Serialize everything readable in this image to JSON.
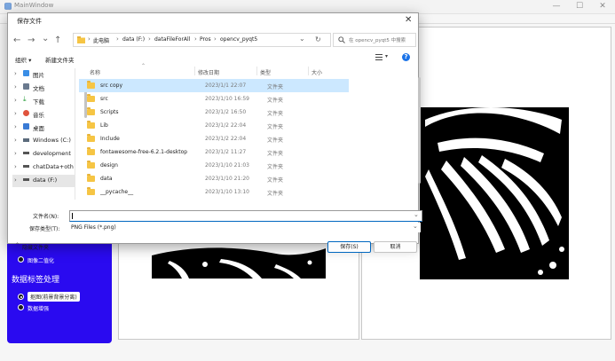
{
  "main_window": {
    "title": "MainWindow",
    "controls": {
      "minimize": "—",
      "maximize": "☐",
      "close": "✕"
    }
  },
  "sidebar": {
    "items": [
      {
        "label": "图像二值化",
        "checked": false
      },
      {
        "label": "数据标签处理",
        "heading": true
      },
      {
        "label": "抠图(前景背景分离)",
        "checked": true
      },
      {
        "label": "数据增强",
        "checked": false
      }
    ]
  },
  "dialog": {
    "title": "保存文件",
    "close": "✕",
    "nav": {
      "back": "←",
      "forward": "→",
      "dropdown": "⌄",
      "up": "↑",
      "refresh": "↻"
    },
    "breadcrumb": [
      "此电脑",
      "data (F:)",
      "dataFileForAll",
      "Pros",
      "opencv_pyqt5"
    ],
    "search_placeholder": "在 opencv_pyqt5 中搜索",
    "toolbar": {
      "organize": "组织 ▾",
      "new_folder": "新建文件夹",
      "help": "?"
    },
    "nav_pane": [
      {
        "label": "图片",
        "icon": "pictures-icon",
        "color": "#3a8ee6"
      },
      {
        "label": "文档",
        "icon": "documents-icon",
        "color": "#6b7a8f"
      },
      {
        "label": "下载",
        "icon": "downloads-icon",
        "color": "#2a9d3a"
      },
      {
        "label": "音乐",
        "icon": "music-icon",
        "color": "#e0533d"
      },
      {
        "label": "桌面",
        "icon": "desktop-icon",
        "color": "#3a7bd5"
      },
      {
        "label": "Windows (C:)",
        "icon": "drive-icon",
        "color": "#5b6b7c"
      },
      {
        "label": "development",
        "icon": "drive-icon",
        "color": "#555555"
      },
      {
        "label": "chatData+oth",
        "icon": "drive-icon",
        "color": "#555555"
      },
      {
        "label": "data (F:)",
        "icon": "drive-icon",
        "color": "#555555",
        "selected": true
      }
    ],
    "columns": {
      "name": "名称",
      "modified": "修改日期",
      "type": "类型",
      "size": "大小"
    },
    "files": [
      {
        "name": "src copy",
        "date": "2023/1/1 22:07",
        "type": "文件夹",
        "selected": true
      },
      {
        "name": "src",
        "date": "2023/1/10 16:59",
        "type": "文件夹"
      },
      {
        "name": "Scripts",
        "date": "2023/1/2 16:50",
        "type": "文件夹"
      },
      {
        "name": "Lib",
        "date": "2023/1/2 22:04",
        "type": "文件夹"
      },
      {
        "name": "Include",
        "date": "2023/1/2 22:04",
        "type": "文件夹"
      },
      {
        "name": "fontawesome-free-6.2.1-desktop",
        "date": "2023/1/2 11:27",
        "type": "文件夹"
      },
      {
        "name": "design",
        "date": "2023/1/10 21:03",
        "type": "文件夹"
      },
      {
        "name": "data",
        "date": "2023/1/10 21:20",
        "type": "文件夹"
      },
      {
        "name": "__pycache__",
        "date": "2023/1/10 13:10",
        "type": "文件夹"
      }
    ],
    "filename_label": "文件名(N):",
    "filename_value": "",
    "filetype_label": "保存类型(T):",
    "filetype_value": "PNG Files (*.png)",
    "hide_folders": "隐藏文件夹",
    "save": "保存(S)",
    "cancel": "取消",
    "colors": {
      "accent": "#0067c0",
      "selected_row": "#cce8ff",
      "folder": "#f6c544"
    }
  }
}
